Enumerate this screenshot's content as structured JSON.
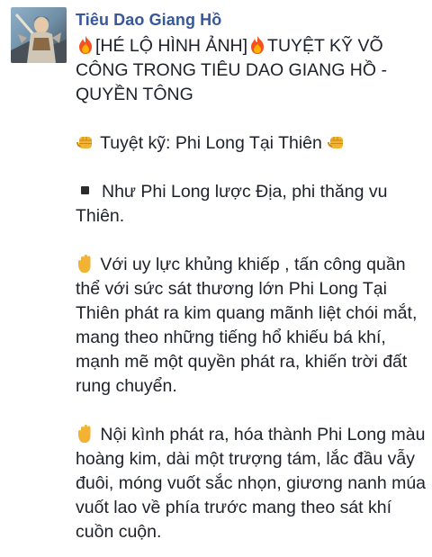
{
  "post": {
    "author": "Tiêu Dao Giang Hồ",
    "title_part1": "[HÉ LỘ HÌNH ẢNH]",
    "title_part2": "TUYỆT KỸ VÕ CÔNG TRONG TIÊU DAO GIANG HỒ - QUYỀN TÔNG",
    "skill_line": " Tuyệt kỹ: Phi Long Tại Thiên ",
    "bullet_text": "Như Phi Long lược Địa, phi thăng vu Thiên.",
    "para1": " Với uy lực khủng khiếp , tấn công quần thể với sức sát thương lớn Phi Long Tại Thiên phát ra kim quang mãnh liệt chói mắt, mang theo những tiếng hổ khiếu bá khí, mạnh mẽ một quyền phát ra, khiến trời đất rung chuyển.",
    "para2": " Nội kình phát ra, hóa thành Phi Long màu hoàng kim, dài một trượng tám, lắc đầu vẫy đuôi, móng vuốt sắc nhọn, giương nanh múa vuốt lao về phía trước mang theo sát khí cuồn cuộn."
  },
  "icons": [
    "fire-icon",
    "fist-icon",
    "raised-hand-icon",
    "square-bullet-icon"
  ],
  "colors": {
    "author": "#365899",
    "text": "#1d2129"
  }
}
